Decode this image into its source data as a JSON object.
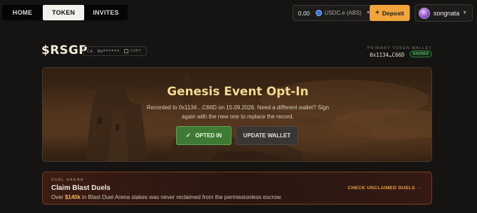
{
  "nav": {
    "tabs": [
      {
        "label": "HOME"
      },
      {
        "label": "TOKEN"
      },
      {
        "label": "INVITES"
      }
    ]
  },
  "wallet": {
    "balance": "0.00",
    "token": "USDC.e (ABS)",
    "deposit_label": "Deposit"
  },
  "user": {
    "name": "songnata"
  },
  "token_header": {
    "ticker": "$RSGP",
    "ca_label": "CA",
    "ca_value": "0x******",
    "copy_label": "COPY",
    "wallet_label": "PRIMARY TOKEN WALLET",
    "wallet_address": "0x1134…C66D",
    "signed_badge": "SIGNED"
  },
  "genesis": {
    "title": "Genesis Event Opt-In",
    "description": "Recorded to 0x1134…C66D on 15.09.2026. Need a different wallet? Sign again with the new one to replace the record.",
    "opted_label": "OPTED IN",
    "update_label": "UPDATE WALLET"
  },
  "duel": {
    "label": "DUEL ARENA",
    "title": "Claim Blast Duels",
    "desc_prefix": "Over ",
    "amount": "$140k",
    "desc_suffix": " in Blast Duel Arena stakes was never reclaimed from the permissionless escrow.",
    "link_label": "CHECK UNCLAIMED DUELS"
  },
  "colors": {
    "accent": "#f2a63a",
    "success": "#3e7a33",
    "title_gold": "#f3d890"
  }
}
